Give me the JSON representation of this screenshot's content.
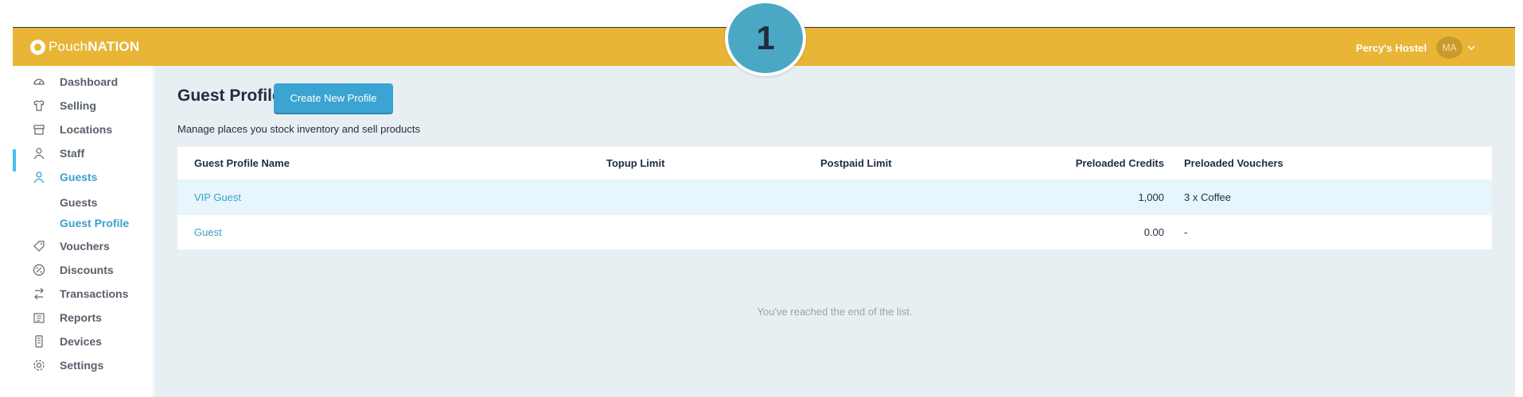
{
  "brand": {
    "part1": "Pouch",
    "part2": "NATION"
  },
  "user": {
    "venue": "Percy's Hostel",
    "initials": "MA"
  },
  "step_badge": "1",
  "sidebar": {
    "items": [
      {
        "label": "Dashboard",
        "icon": "dashboard-icon"
      },
      {
        "label": "Selling",
        "icon": "shirt-icon"
      },
      {
        "label": "Locations",
        "icon": "store-icon"
      },
      {
        "label": "Staff",
        "icon": "user-icon"
      },
      {
        "label": "Guests",
        "icon": "user-icon"
      },
      {
        "label": "Vouchers",
        "icon": "tag-icon"
      },
      {
        "label": "Discounts",
        "icon": "percent-icon"
      },
      {
        "label": "Transactions",
        "icon": "transactions-icon"
      },
      {
        "label": "Reports",
        "icon": "reports-icon"
      },
      {
        "label": "Devices",
        "icon": "device-icon"
      },
      {
        "label": "Settings",
        "icon": "gear-icon"
      }
    ],
    "sub_items": [
      {
        "label": "Guests"
      },
      {
        "label": "Guest Profile"
      }
    ]
  },
  "page": {
    "title": "Guest Profiles",
    "create_button": "Create New Profile",
    "subtitle": "Manage places you stock inventory and sell products",
    "end_message": "You've reached the end of the list."
  },
  "table": {
    "headers": {
      "name": "Guest Profile Name",
      "topup": "Topup Limit",
      "postpaid": "Postpaid Limit",
      "credits": "Preloaded Credits",
      "vouchers": "Preloaded Vouchers"
    },
    "rows": [
      {
        "name": "VIP Guest",
        "topup": "",
        "postpaid": "",
        "credits": "1,000",
        "vouchers": "3 x Coffee"
      },
      {
        "name": "Guest",
        "topup": "",
        "postpaid": "",
        "credits": "0.00",
        "vouchers": "-"
      }
    ]
  },
  "colors": {
    "topbar": "#e8b537",
    "accent": "#3c9fce",
    "active_bar": "#45c1ee",
    "main_bg": "#e7eff2"
  }
}
